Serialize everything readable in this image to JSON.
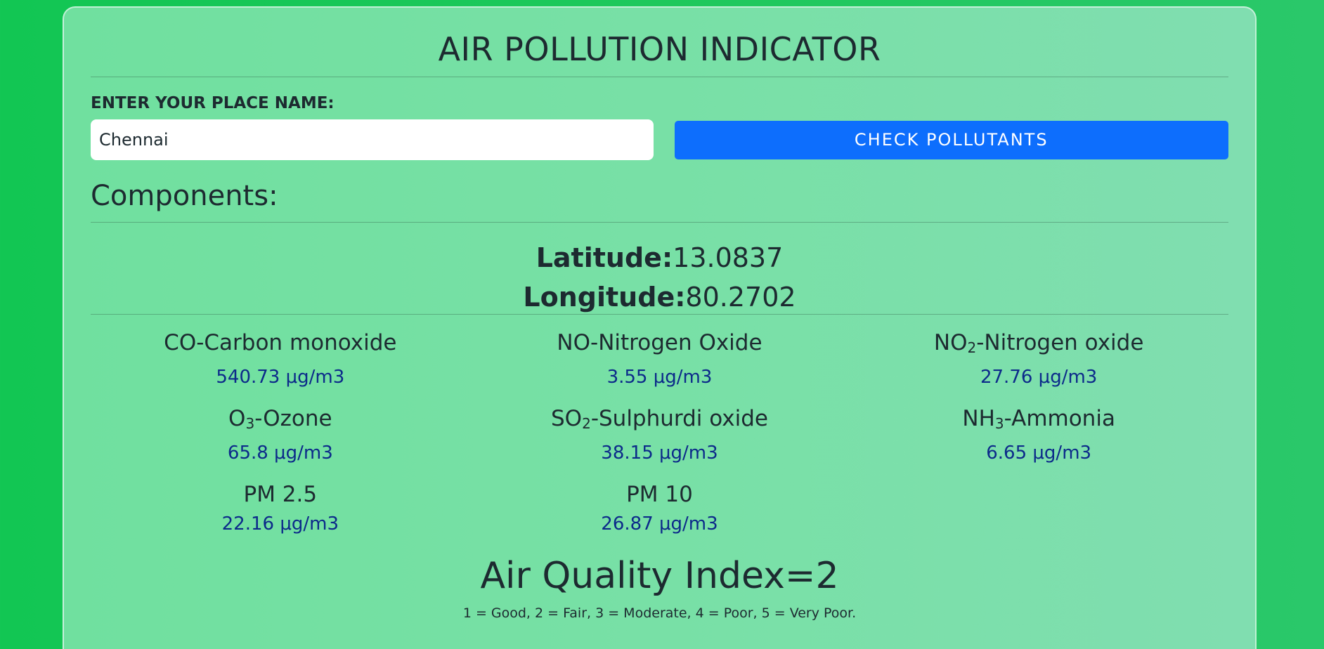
{
  "app": {
    "title": "AIR POLLUTION INDICATOR"
  },
  "search": {
    "label": "ENTER YOUR PLACE NAME:",
    "value": "Chennai",
    "button_label": "CHECK POLLUTANTS"
  },
  "components": {
    "heading": "Components:",
    "latitude_label": "Latitude:",
    "latitude_value": "13.0837",
    "longitude_label": "Longitude:",
    "longitude_value": "80.2702"
  },
  "pollutants": [
    {
      "formula_base": "CO",
      "formula_sub": "",
      "name": "-Carbon monoxide",
      "value": "540.73 μg/m3"
    },
    {
      "formula_base": "NO",
      "formula_sub": "",
      "name": "-Nitrogen Oxide",
      "value": "3.55 μg/m3"
    },
    {
      "formula_base": "NO",
      "formula_sub": "2",
      "name": "-Nitrogen oxide",
      "value": "27.76 μg/m3"
    },
    {
      "formula_base": "O",
      "formula_sub": "3",
      "name": "-Ozone",
      "value": "65.8 μg/m3"
    },
    {
      "formula_base": "SO",
      "formula_sub": "2",
      "name": "-Sulphurdi oxide",
      "value": "38.15 μg/m3"
    },
    {
      "formula_base": "NH",
      "formula_sub": "3",
      "name": "-Ammonia",
      "value": "6.65 μg/m3"
    },
    {
      "formula_base": "PM 2.5",
      "formula_sub": "",
      "name": "",
      "value": "22.16 μg/m3"
    },
    {
      "formula_base": "PM 10",
      "formula_sub": "",
      "name": "",
      "value": "26.87 μg/m3"
    }
  ],
  "aqi": {
    "text": "Air Quality Index=2",
    "legend": "1 = Good, 2 = Fair, 3 = Moderate, 4 = Poor, 5 = Very Poor."
  }
}
